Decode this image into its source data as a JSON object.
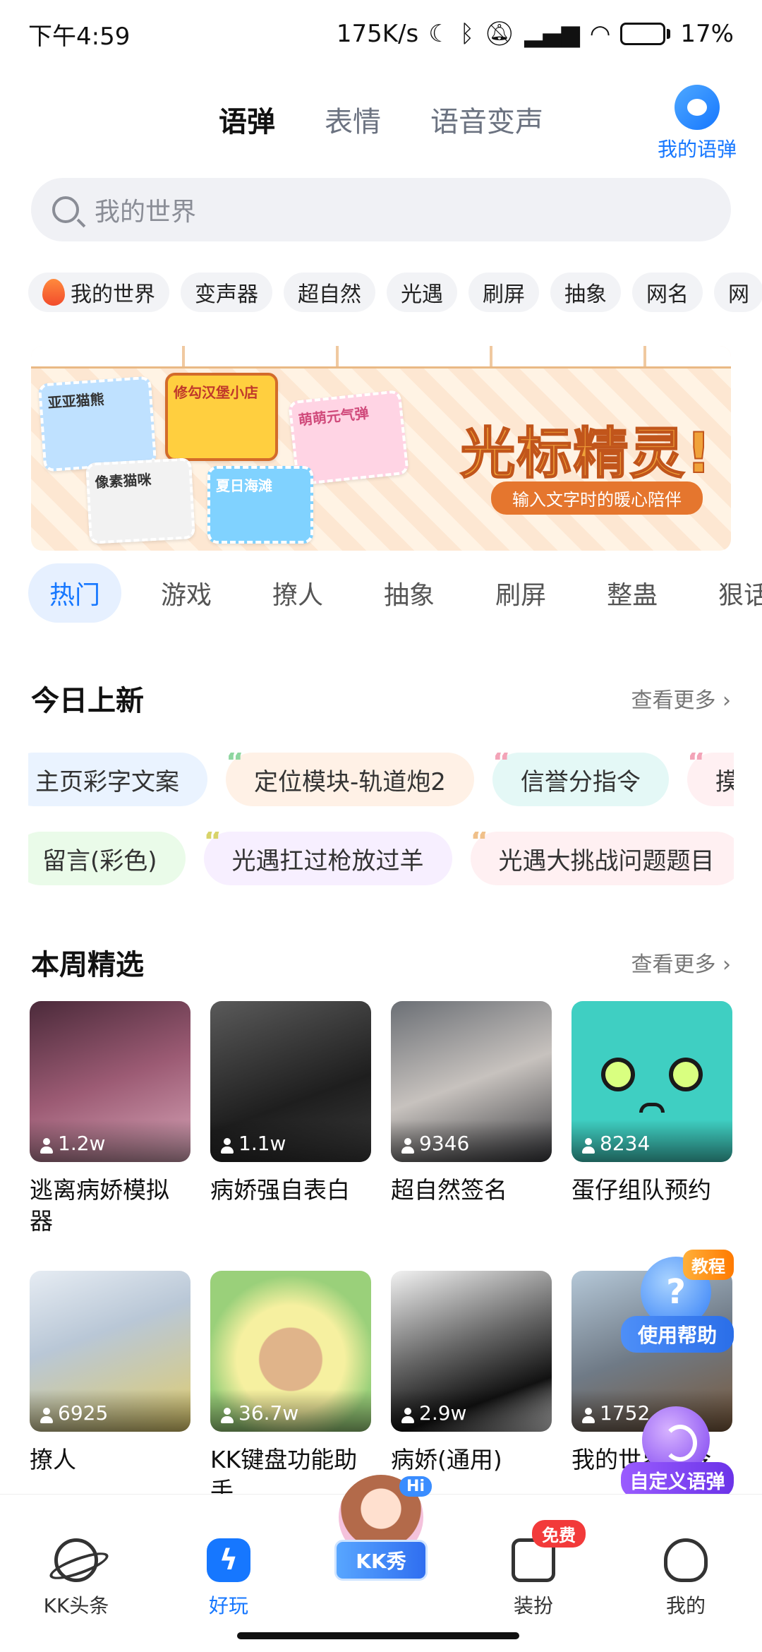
{
  "status": {
    "time": "下午4:59",
    "net_speed": "175K/s",
    "battery": "17%"
  },
  "top_tabs": [
    {
      "label": "语弹",
      "active": true
    },
    {
      "label": "表情",
      "active": false
    },
    {
      "label": "语音变声",
      "active": false
    }
  ],
  "my_yudan": {
    "label": "我的语弹",
    "icon": "chat-bubble-icon"
  },
  "search": {
    "placeholder": "我的世界"
  },
  "chips": [
    "我的世界",
    "变声器",
    "超自然",
    "光遇",
    "刷屏",
    "抽象",
    "网名",
    "网"
  ],
  "banner": {
    "title": "光标精灵!",
    "subtitle": "输入文字时的暖心陪伴",
    "stickers": [
      "亚亚猫熊",
      "修勾汉堡小店",
      "萌萌元气弹",
      "像素猫咪",
      "夏日海滩"
    ]
  },
  "category_tabs": [
    {
      "label": "热门",
      "active": true
    },
    {
      "label": "游戏"
    },
    {
      "label": "撩人"
    },
    {
      "label": "抽象"
    },
    {
      "label": "刷屏"
    },
    {
      "label": "整蛊"
    },
    {
      "label": "狠话"
    }
  ],
  "today_new": {
    "title": "今日上新",
    "more": "查看更多",
    "row1": [
      "主页彩字文案",
      "定位模块-轨道炮2",
      "信誉分指令",
      "摸"
    ],
    "row2": [
      "留言(彩色)",
      "光遇扛过枪放过羊",
      "光遇大挑战问题题目"
    ]
  },
  "weekly": {
    "title": "本周精选",
    "more": "查看更多",
    "cards": [
      {
        "title": "逃离病娇模拟器",
        "count": "1.2w"
      },
      {
        "title": "病娇强自表白",
        "count": "1.1w"
      },
      {
        "title": "超自然签名",
        "count": "9346"
      },
      {
        "title": "蛋仔组队预约",
        "count": "8234"
      },
      {
        "title": "撩人",
        "count": "6925"
      },
      {
        "title": "KK键盘功能助手",
        "count": "36.7w"
      },
      {
        "title": "病娇(通用)",
        "count": "2.9w"
      },
      {
        "title": "我的世界指令",
        "count": "1752"
      }
    ]
  },
  "floating": {
    "help_tag": "教程",
    "help_label": "使用帮助",
    "custom_label": "自定义语弹"
  },
  "bottom_nav": [
    {
      "label": "KK头条",
      "icon": "planet-icon"
    },
    {
      "label": "好玩",
      "icon": "bolt-icon",
      "active": true
    },
    {
      "label": "KK秀",
      "icon": "avatar-icon",
      "badge": "Hi"
    },
    {
      "label": "装扮",
      "icon": "shirt-icon",
      "badge": "免费"
    },
    {
      "label": "我的",
      "icon": "ghost-icon"
    }
  ],
  "colors": {
    "accent": "#1677ff",
    "highlight": "#ffd43b",
    "badge_red": "#f23a3a"
  }
}
